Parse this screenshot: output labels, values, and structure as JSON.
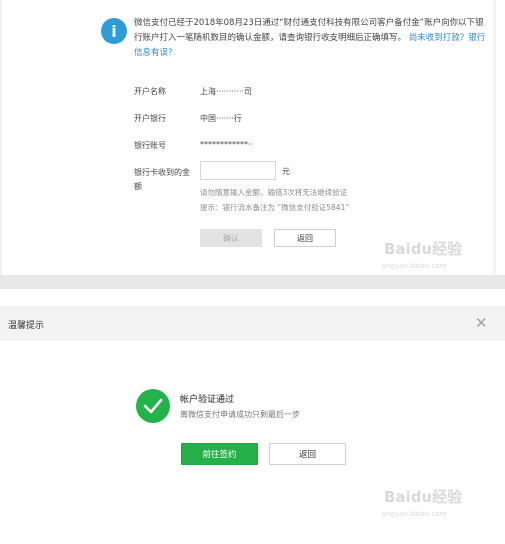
{
  "top": {
    "notice": {
      "text": "微信支付已经于2018年08月23日通过“财付通支付科技有限公司客户备付金”账户向你以下银行账户打入一笔随机数目的确认金额，请查询银行收支明细后正确填写。",
      "link": "尚未收到打款？银行信息有误？"
    },
    "fields": [
      {
        "label": "开户名称",
        "value": "上海···········司"
      },
      {
        "label": "开户银行",
        "value": "中国·······行"
      },
      {
        "label": "银行账号",
        "value": "************··"
      }
    ],
    "amount": {
      "label": "银行卡收到的金额",
      "unit": "元",
      "value": ""
    },
    "hints": [
      "请勿随意输入金额，输错3次将无法继续验证",
      "提示：银行流水备注为 “微信支付验证5841”"
    ],
    "buttons": {
      "confirm": "确认",
      "back": "返回"
    }
  },
  "dialog": {
    "title": "温馨提示",
    "success_title": "帐户验证通过",
    "success_sub": "离微信支付申请成功只剩最后一步",
    "buttons": {
      "sign": "前往签约",
      "back": "返回"
    }
  },
  "watermark": {
    "brand": "Baidu经验",
    "url": "jingyan.baidu.com"
  },
  "colors": {
    "info_blue": "#2e9cd9",
    "success_green": "#23b34a",
    "link_blue": "#2a8ad6"
  }
}
